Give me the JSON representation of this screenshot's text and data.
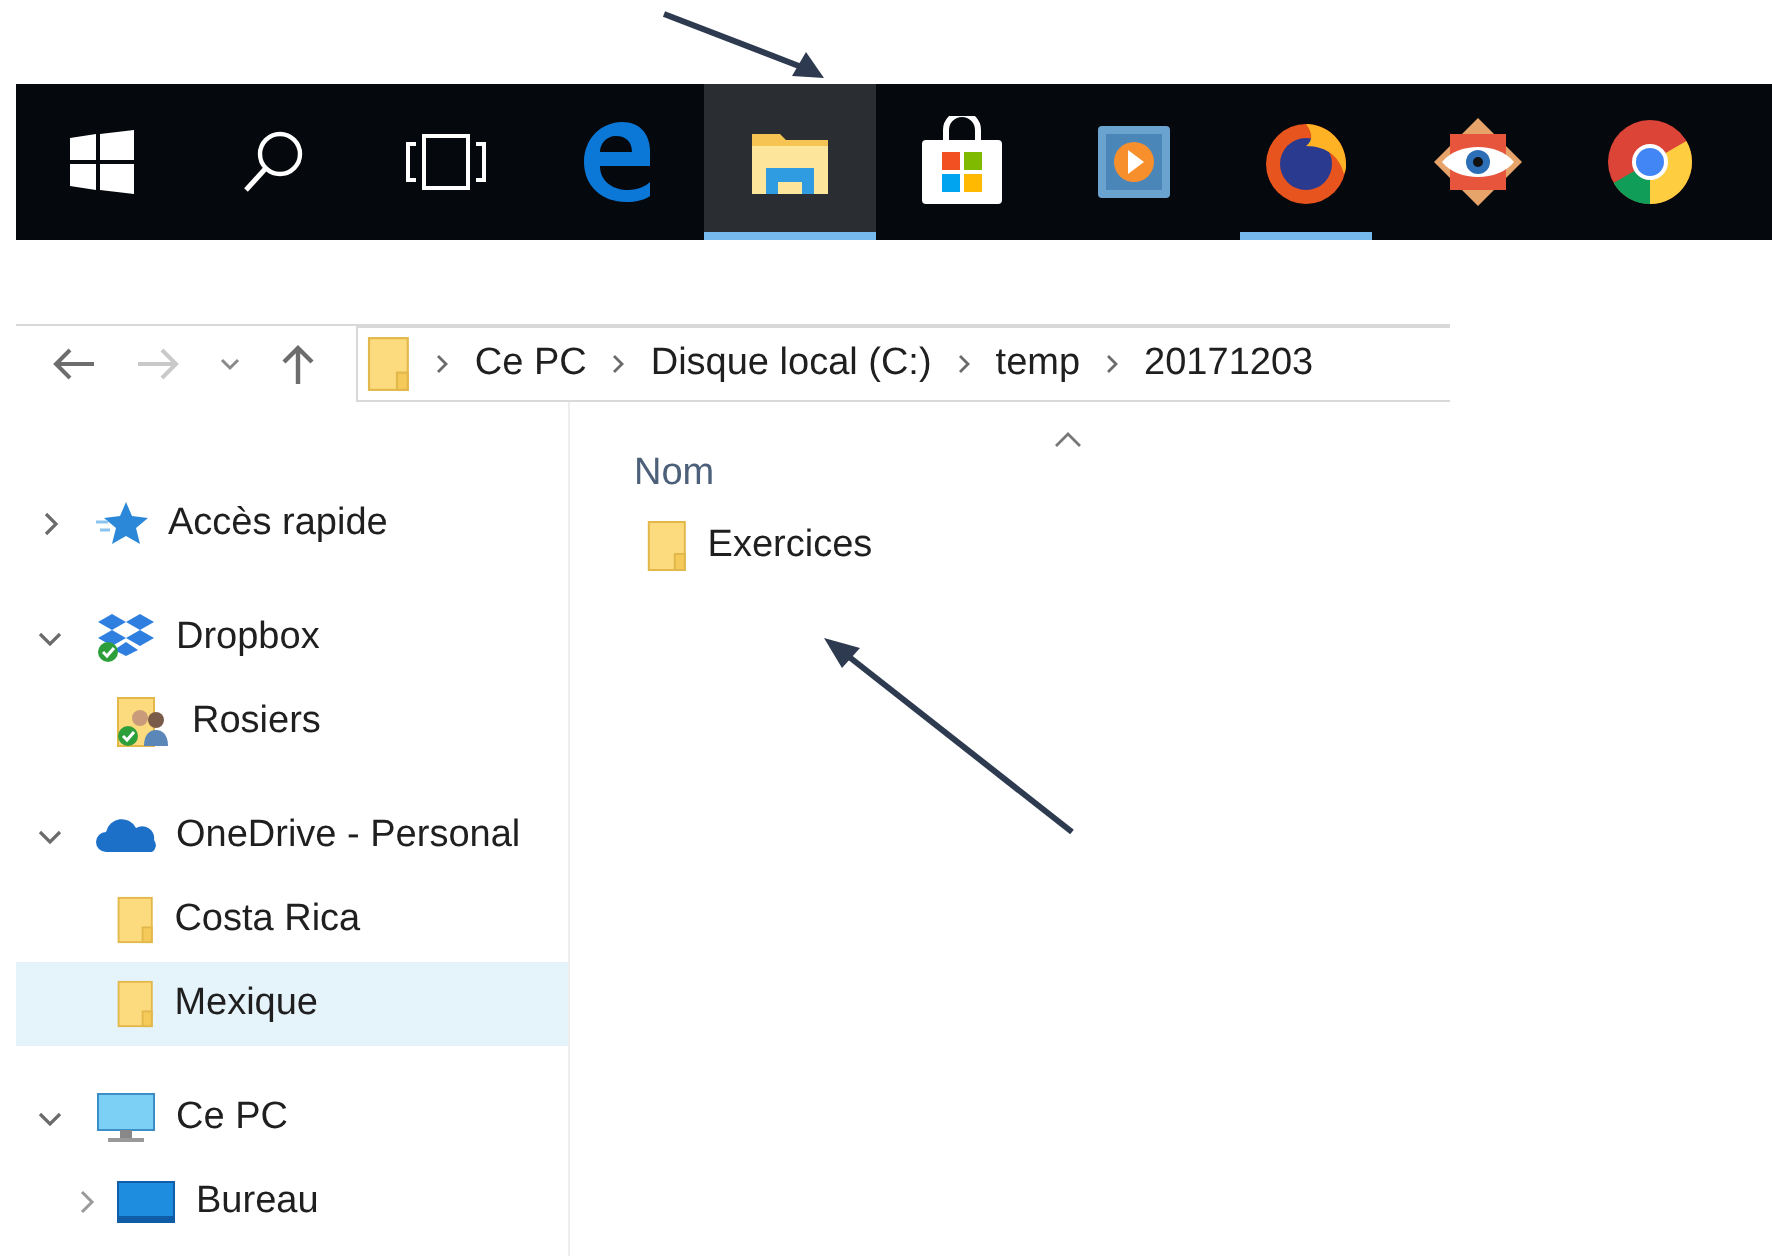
{
  "taskbar": {
    "items": [
      {
        "kind": "start",
        "selected": false,
        "running": false
      },
      {
        "kind": "search",
        "selected": false,
        "running": false
      },
      {
        "kind": "taskview",
        "selected": false,
        "running": false
      },
      {
        "kind": "edge",
        "selected": false,
        "running": false
      },
      {
        "kind": "explorer",
        "selected": true,
        "running": true
      },
      {
        "kind": "store",
        "selected": false,
        "running": false
      },
      {
        "kind": "media",
        "selected": false,
        "running": false
      },
      {
        "kind": "firefox",
        "selected": false,
        "running": true
      },
      {
        "kind": "eye",
        "selected": false,
        "running": false
      },
      {
        "kind": "chrome",
        "selected": false,
        "running": false
      }
    ]
  },
  "explorer": {
    "breadcrumb": [
      "Ce PC",
      "Disque local (C:)",
      "temp",
      "20171203"
    ],
    "tree": [
      {
        "label": "Accès rapide",
        "kind": "quick",
        "expanded": false,
        "selected": false
      },
      {
        "label": "Dropbox",
        "kind": "dropbox",
        "expanded": true,
        "selected": false,
        "children": [
          {
            "label": "Rosiers",
            "kind": "shared",
            "selected": false,
            "expandable": false
          }
        ]
      },
      {
        "label": "OneDrive - Personal",
        "kind": "onedrive",
        "expanded": true,
        "selected": false,
        "children": [
          {
            "label": "Costa Rica",
            "kind": "folder",
            "selected": false,
            "expandable": false
          },
          {
            "label": "Mexique",
            "kind": "folder",
            "selected": true,
            "expandable": false
          }
        ]
      },
      {
        "label": "Ce PC",
        "kind": "pc",
        "expanded": true,
        "selected": false,
        "children": [
          {
            "label": "Bureau",
            "kind": "desktop",
            "selected": false,
            "expandable": true
          }
        ]
      }
    ],
    "column": "Nom",
    "files": [
      {
        "name": "Exercices"
      }
    ]
  }
}
